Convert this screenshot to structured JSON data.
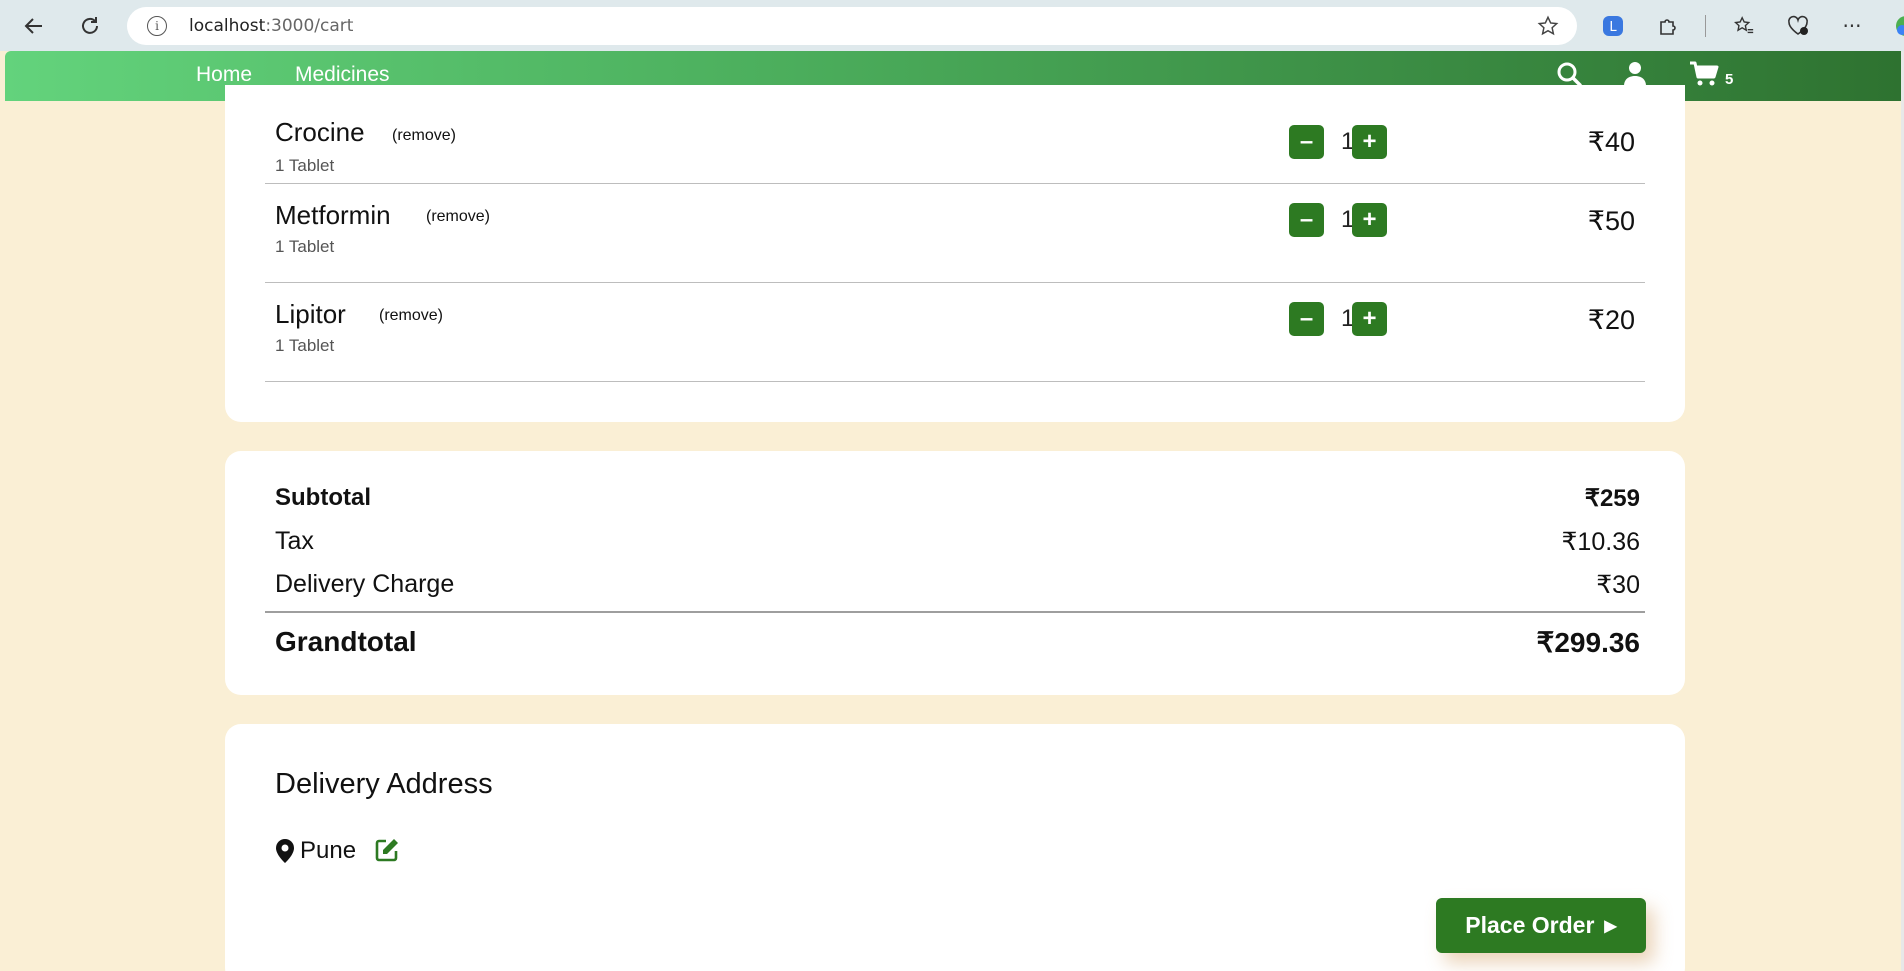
{
  "browser": {
    "url_host": "localhost",
    "url_rest": ":3000/cart"
  },
  "navbar": {
    "home_label": "Home",
    "medicines_label": "Medicines",
    "cart_count": "5"
  },
  "cart": {
    "items": [
      {
        "name": "Crocine",
        "remove_label": "(remove)",
        "unit": "1 Tablet",
        "qty": "1",
        "price": "₹40"
      },
      {
        "name": "Metformin",
        "remove_label": "(remove)",
        "unit": "1 Tablet",
        "qty": "1",
        "price": "₹50"
      },
      {
        "name": "Lipitor",
        "remove_label": "(remove)",
        "unit": "1 Tablet",
        "qty": "1",
        "price": "₹20"
      }
    ],
    "minus_label": "–",
    "plus_label": "+"
  },
  "summary": {
    "subtotal_label": "Subtotal",
    "subtotal_value": "₹259",
    "tax_label": "Tax",
    "tax_value": "₹10.36",
    "delivery_label": "Delivery Charge",
    "delivery_value": "₹30",
    "grandtotal_label": "Grandtotal",
    "grandtotal_value": "₹299.36"
  },
  "address": {
    "title": "Delivery Address",
    "city": "Pune",
    "place_order_label": "Place Order"
  },
  "colors": {
    "accent_green": "#2d7a22",
    "page_bg": "#faefd5"
  }
}
